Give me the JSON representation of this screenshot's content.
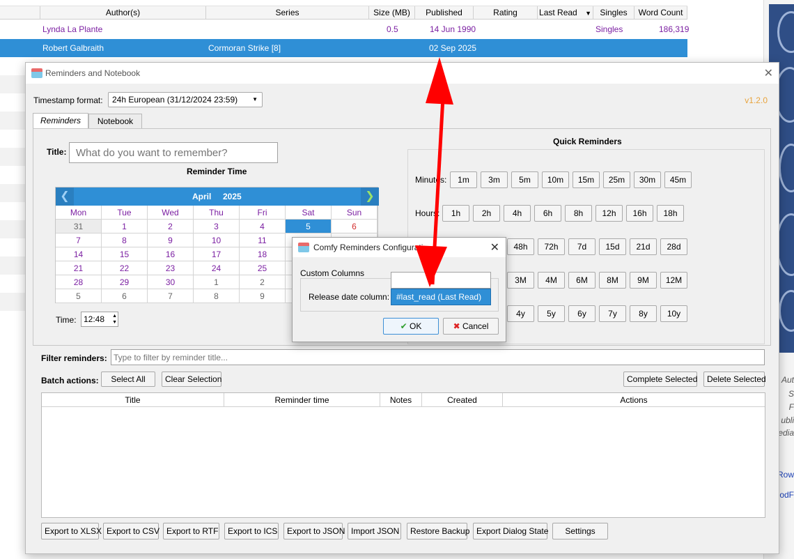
{
  "library": {
    "columns": [
      "Author(s)",
      "Series",
      "Size (MB)",
      "Published",
      "Rating",
      "Last Read",
      "Singles",
      "Word Count"
    ],
    "rows": [
      {
        "author": "Lynda La Plante",
        "series": "",
        "size": "0.5",
        "published": "14 Jun 1990",
        "singles": "Singles",
        "words": "186,319",
        "selected": false
      },
      {
        "author": "Robert Galbraith",
        "series": "Cormoran Strike [8]",
        "size": "",
        "published": "02 Sep 2025",
        "singles": "",
        "words": "",
        "selected": true
      }
    ],
    "side_text": [
      "Aut",
      "S",
      "F",
      "ubli",
      "edia",
      "Row",
      "odF"
    ],
    "sort_icon": "sort-down-icon"
  },
  "main_dialog": {
    "title": "Reminders and Notebook",
    "timestamp_label": "Timestamp format:",
    "timestamp_value": "24h European (31/12/2024 23:59)",
    "version": "v1.2.0",
    "tabs": [
      "Reminders",
      "Notebook"
    ],
    "title_label": "Title:",
    "title_placeholder": "What do you want to remember?",
    "reminder_time_label": "Reminder Time",
    "calendar": {
      "month": "April",
      "year": "2025",
      "days": [
        "Mon",
        "Tue",
        "Wed",
        "Thu",
        "Fri",
        "Sat",
        "Sun"
      ],
      "weeks": [
        [
          "31",
          "1",
          "2",
          "3",
          "4",
          "5",
          "6"
        ],
        [
          "7",
          "8",
          "9",
          "10",
          "11",
          "",
          ""
        ],
        [
          "14",
          "15",
          "16",
          "17",
          "18",
          "",
          ""
        ],
        [
          "21",
          "22",
          "23",
          "24",
          "25",
          "",
          ""
        ],
        [
          "28",
          "29",
          "30",
          "1",
          "2",
          "",
          ""
        ],
        [
          "5",
          "6",
          "7",
          "8",
          "9",
          "",
          ""
        ]
      ],
      "selected": "5"
    },
    "time_label": "Time:",
    "time_value": "12:48",
    "quick_reminders_label": "Quick Reminders",
    "quick_rows": [
      {
        "label": "Minutes:",
        "buttons": [
          "1m",
          "3m",
          "5m",
          "10m",
          "15m",
          "25m",
          "30m",
          "45m"
        ]
      },
      {
        "label": "Hours:",
        "buttons": [
          "1h",
          "2h",
          "4h",
          "6h",
          "8h",
          "12h",
          "16h",
          "18h"
        ]
      },
      {
        "label": "",
        "buttons": [
          "48h",
          "72h",
          "7d",
          "15d",
          "21d",
          "28d"
        ]
      },
      {
        "label": "",
        "buttons": [
          "3M",
          "4M",
          "6M",
          "8M",
          "9M",
          "12M"
        ]
      },
      {
        "label": "",
        "buttons": [
          "4y",
          "5y",
          "6y",
          "7y",
          "8y",
          "10y"
        ]
      }
    ],
    "filter_label": "Filter reminders:",
    "filter_placeholder": "Type to filter by reminder title...",
    "batch_label": "Batch actions:",
    "select_all": "Select All",
    "clear_selection": "Clear Selection",
    "complete_selected": "Complete Selected",
    "delete_selected": "Delete Selected",
    "table_columns": [
      "Title",
      "Reminder time",
      "Notes",
      "Created",
      "Actions"
    ],
    "footer_buttons": [
      "Export to XLSX",
      "Export to CSV",
      "Export to RTF",
      "Export to ICS",
      "Export to JSON",
      "Import JSON",
      "Restore Backup",
      "Export Dialog State",
      "Settings"
    ]
  },
  "config_dialog": {
    "title": "Comfy Reminders Configurati",
    "group_label": "Custom Columns",
    "field_label": "Release date column:",
    "field_value": "",
    "dropdown_option": "#last_read (Last Read)",
    "ok": "OK",
    "cancel": "Cancel"
  },
  "colors": {
    "selection": "#2f8fd6",
    "accent_purple": "#7b1fa2",
    "arrow_red": "#ff0000",
    "version_orange": "#e8a33c",
    "weekend_red": "#d32f2f"
  }
}
